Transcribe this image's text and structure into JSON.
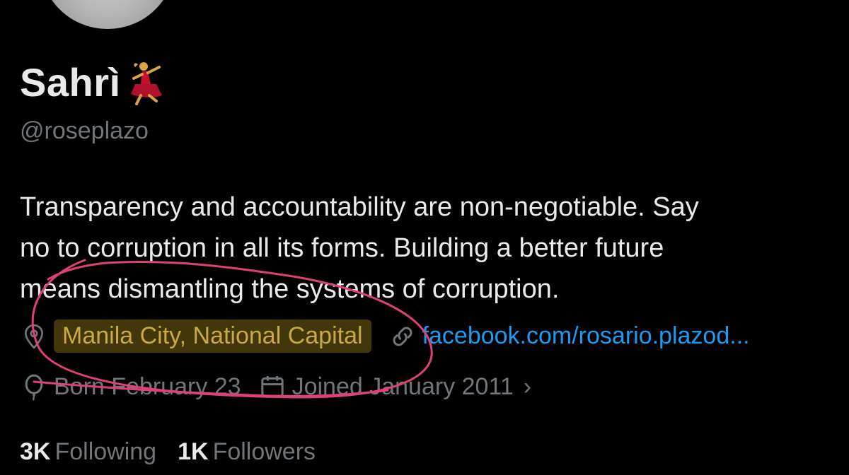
{
  "profile": {
    "display_name": "Sahrì",
    "name_emoji_icon": "woman-dancing-icon",
    "handle": "@roseplazo",
    "bio_lines": [
      "Transparency and accountability are non-negotiable. Say",
      "no to corruption in all its forms. Building a better future",
      "means dismantling the systems of corruption."
    ]
  },
  "meta": {
    "location": "Manila City, National Capital",
    "location_icon": "location-pin-icon",
    "link": "facebook.com/rosario.plazod...",
    "link_icon": "link-icon",
    "born": "Born February 23",
    "born_icon": "balloon-icon",
    "joined": "Joined January 2011",
    "joined_icon": "calendar-icon",
    "chevron": "›"
  },
  "stats": {
    "following_count": "3K",
    "following_label": "Following",
    "followers_count": "1K",
    "followers_label": "Followers"
  },
  "colors": {
    "background": "#000000",
    "text": "#e7e9ea",
    "muted": "#71767b",
    "link": "#1d9bf0",
    "annotation": "#e0407a"
  }
}
